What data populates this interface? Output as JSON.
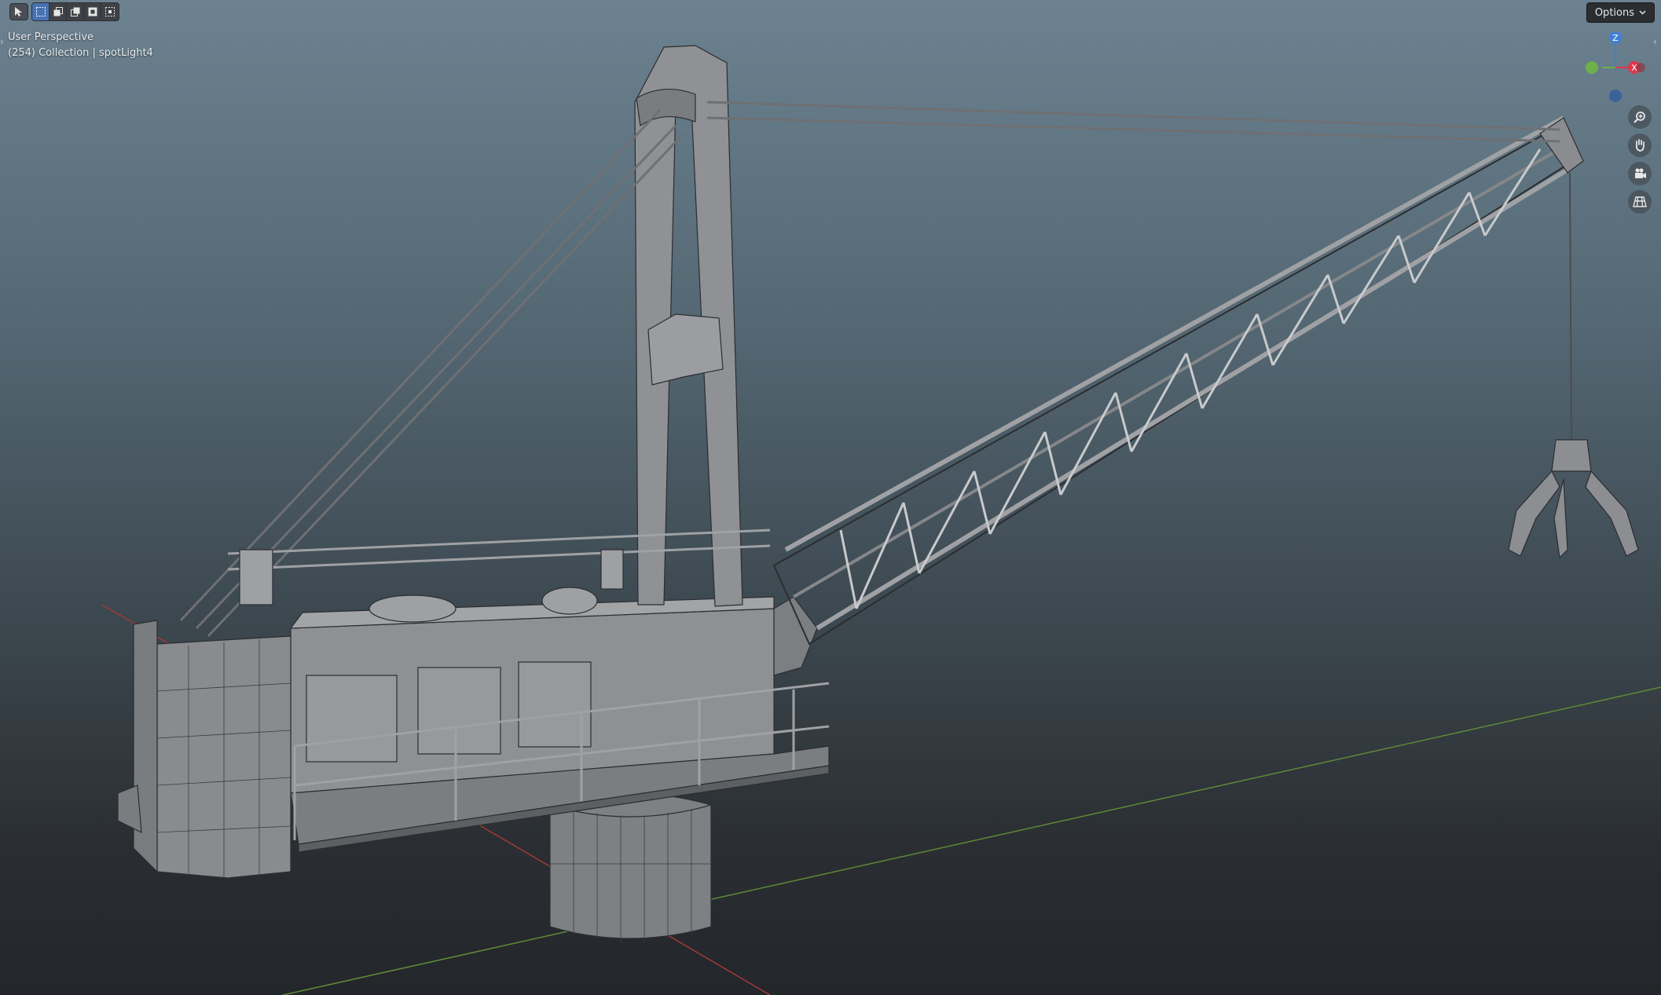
{
  "viewport": {
    "view_name": "User Perspective",
    "collection_info": "(254) Collection | spotLight4",
    "background_top": "#6c8290",
    "background_bottom": "#23262a"
  },
  "header": {
    "select_tool_icon": "cursor-select-icon",
    "select_modes": [
      "select-new-icon",
      "select-extend-icon",
      "select-subtract-icon",
      "select-invert-icon",
      "select-intersect-icon"
    ],
    "options_label": "Options"
  },
  "gizmo": {
    "z_label": "Z",
    "x_label": "X",
    "x_color": "#e0364b",
    "y_color": "#6fb04a",
    "z_color": "#3f7fd6"
  },
  "navigation": {
    "buttons": [
      "zoom-icon",
      "pan-hand-icon",
      "camera-icon",
      "grid-view-icon"
    ]
  },
  "scene": {
    "object": "crane wireframe model",
    "grid_x_axis_color": "#a03a3a",
    "grid_y_axis_color": "#5f8a36"
  }
}
